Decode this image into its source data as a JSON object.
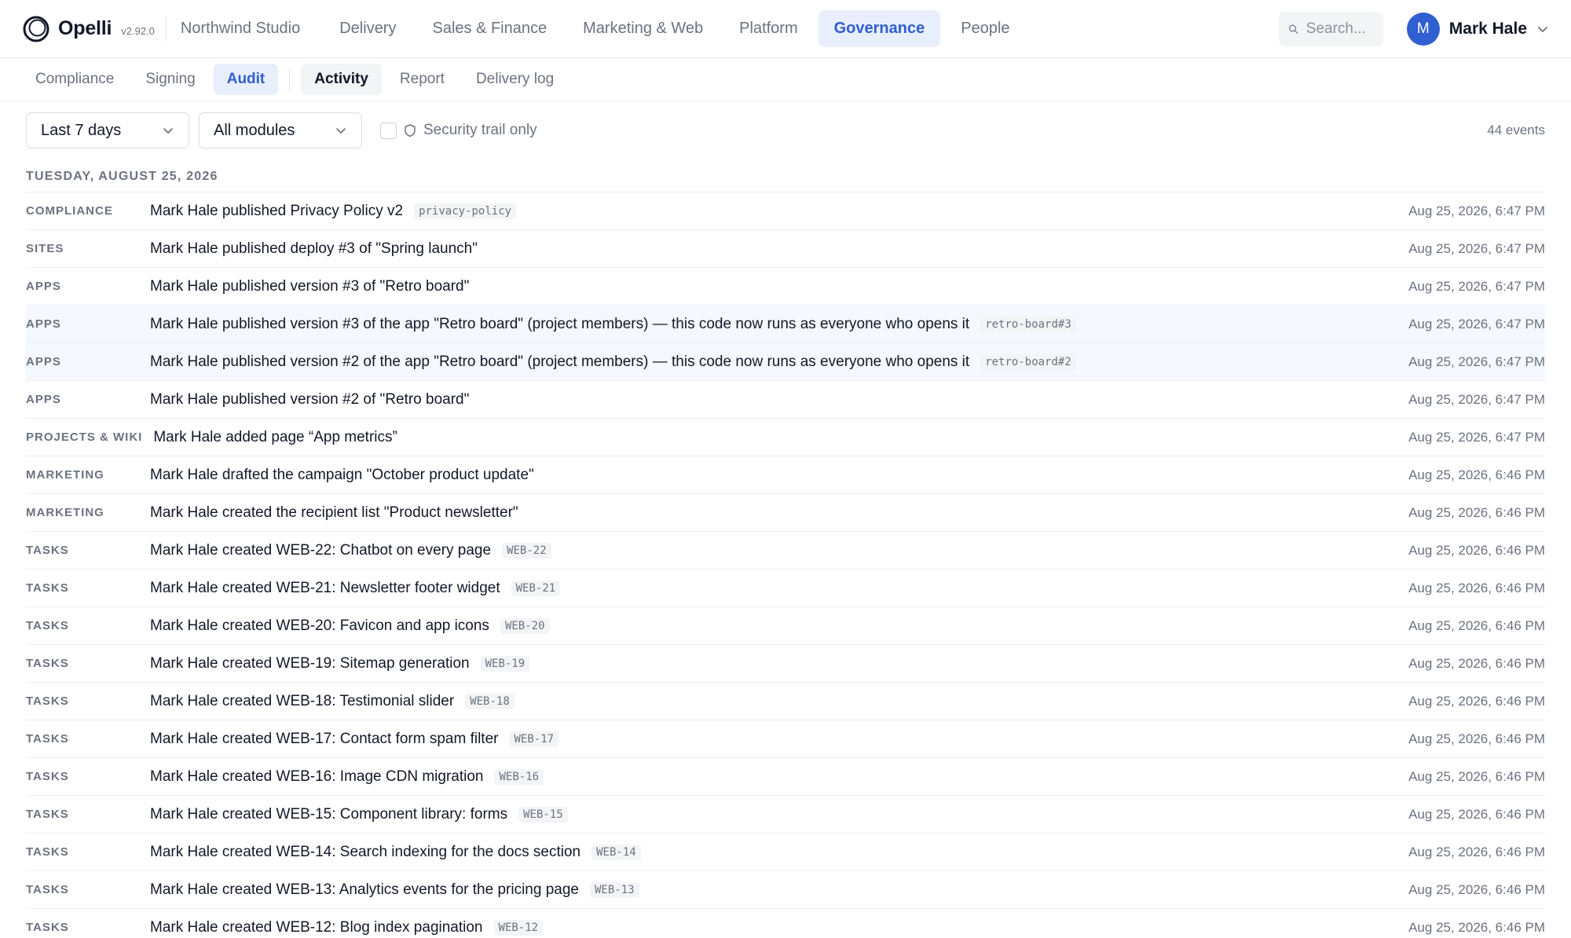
{
  "app": {
    "name": "Opelli",
    "version": "v2.92.0"
  },
  "nav": {
    "workspace": "Northwind Studio",
    "items": [
      "Delivery",
      "Sales & Finance",
      "Marketing & Web",
      "Platform",
      "Governance",
      "People"
    ],
    "active": "Governance"
  },
  "search": {
    "placeholder": "Search..."
  },
  "user": {
    "initial": "M",
    "name": "Mark Hale"
  },
  "subnav": {
    "group1": [
      "Compliance",
      "Signing",
      "Audit"
    ],
    "group2": [
      "Activity",
      "Report",
      "Delivery log"
    ]
  },
  "filters": {
    "period": "Last 7 days",
    "module": "All modules",
    "security_label": "Security trail only",
    "count": "44 events"
  },
  "day": "TUESDAY, AUGUST 25, 2026",
  "events": [
    {
      "module": "COMPLIANCE",
      "text": "Mark Hale published Privacy Policy v2",
      "tag": "privacy-policy",
      "time": "Aug 25, 2026, 6:47 PM"
    },
    {
      "module": "SITES",
      "text": "Mark Hale published deploy #3 of \"Spring launch\"",
      "tag": "",
      "time": "Aug 25, 2026, 6:47 PM"
    },
    {
      "module": "APPS",
      "text": "Mark Hale published version #3 of \"Retro board\"",
      "tag": "",
      "time": "Aug 25, 2026, 6:47 PM"
    },
    {
      "module": "APPS",
      "text": "Mark Hale published version #3 of the app \"Retro board\" (project members) — this code now runs as everyone who opens it",
      "tag": "retro-board#3",
      "time": "Aug 25, 2026, 6:47 PM",
      "highlight": true
    },
    {
      "module": "APPS",
      "text": "Mark Hale published version #2 of the app \"Retro board\" (project members) — this code now runs as everyone who opens it",
      "tag": "retro-board#2",
      "time": "Aug 25, 2026, 6:47 PM",
      "highlight": true
    },
    {
      "module": "APPS",
      "text": "Mark Hale published version #2 of \"Retro board\"",
      "tag": "",
      "time": "Aug 25, 2026, 6:47 PM"
    },
    {
      "module": "PROJECTS & WIKI",
      "text": "Mark Hale added page “App metrics”",
      "tag": "",
      "time": "Aug 25, 2026, 6:47 PM",
      "wide": true
    },
    {
      "module": "MARKETING",
      "text": "Mark Hale drafted the campaign \"October product update\"",
      "tag": "",
      "time": "Aug 25, 2026, 6:46 PM"
    },
    {
      "module": "MARKETING",
      "text": "Mark Hale created the recipient list \"Product newsletter\"",
      "tag": "",
      "time": "Aug 25, 2026, 6:46 PM"
    },
    {
      "module": "TASKS",
      "text": "Mark Hale created WEB-22: Chatbot on every page",
      "tag": "WEB-22",
      "time": "Aug 25, 2026, 6:46 PM"
    },
    {
      "module": "TASKS",
      "text": "Mark Hale created WEB-21: Newsletter footer widget",
      "tag": "WEB-21",
      "time": "Aug 25, 2026, 6:46 PM"
    },
    {
      "module": "TASKS",
      "text": "Mark Hale created WEB-20: Favicon and app icons",
      "tag": "WEB-20",
      "time": "Aug 25, 2026, 6:46 PM"
    },
    {
      "module": "TASKS",
      "text": "Mark Hale created WEB-19: Sitemap generation",
      "tag": "WEB-19",
      "time": "Aug 25, 2026, 6:46 PM"
    },
    {
      "module": "TASKS",
      "text": "Mark Hale created WEB-18: Testimonial slider",
      "tag": "WEB-18",
      "time": "Aug 25, 2026, 6:46 PM"
    },
    {
      "module": "TASKS",
      "text": "Mark Hale created WEB-17: Contact form spam filter",
      "tag": "WEB-17",
      "time": "Aug 25, 2026, 6:46 PM"
    },
    {
      "module": "TASKS",
      "text": "Mark Hale created WEB-16: Image CDN migration",
      "tag": "WEB-16",
      "time": "Aug 25, 2026, 6:46 PM"
    },
    {
      "module": "TASKS",
      "text": "Mark Hale created WEB-15: Component library: forms",
      "tag": "WEB-15",
      "time": "Aug 25, 2026, 6:46 PM"
    },
    {
      "module": "TASKS",
      "text": "Mark Hale created WEB-14: Search indexing for the docs section",
      "tag": "WEB-14",
      "time": "Aug 25, 2026, 6:46 PM"
    },
    {
      "module": "TASKS",
      "text": "Mark Hale created WEB-13: Analytics events for the pricing page",
      "tag": "WEB-13",
      "time": "Aug 25, 2026, 6:46 PM"
    },
    {
      "module": "TASKS",
      "text": "Mark Hale created WEB-12: Blog index pagination",
      "tag": "WEB-12",
      "time": "Aug 25, 2026, 6:46 PM"
    }
  ],
  "colors": {
    "accent": "#2f5fd0",
    "accent_bg": "#e8eefb",
    "row_highlight": "#f5f8fe"
  },
  "icons": {
    "search": "search-icon",
    "chevron": "chevron-down-icon",
    "shield": "shield-icon",
    "logo": "logo-ring-icon"
  }
}
